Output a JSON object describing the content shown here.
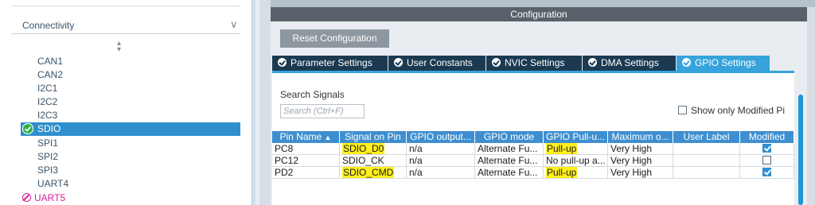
{
  "left_panel": {
    "category": "Connectivity",
    "items": [
      "CAN1",
      "CAN2",
      "I2C1",
      "I2C2",
      "I2C3",
      "SDIO",
      "SPI1",
      "SPI2",
      "SPI3",
      "UART4",
      "UART5"
    ],
    "selected_item": "SDIO"
  },
  "right_panel": {
    "configuration_title": "Configuration",
    "reset_button": "Reset Configuration",
    "tabs": [
      "Parameter Settings",
      "User Constants",
      "NVIC Settings",
      "DMA Settings",
      "GPIO Settings"
    ],
    "active_tab": "GPIO Settings",
    "search": {
      "label": "Search Signals",
      "placeholder": "Search (Ctrl+F)",
      "value": ""
    },
    "show_only_modified": {
      "label": "Show only Modified Pi",
      "checked": false
    },
    "table": {
      "headers": [
        "Pin Name",
        "Signal on Pin",
        "GPIO output...",
        "GPIO mode",
        "GPIO Pull-u...",
        "Maximum o...",
        "User Label",
        "Modified"
      ],
      "rows": [
        {
          "pin": "PC8",
          "signal": "SDIO_D0",
          "output": "n/a",
          "mode": "Alternate Fu...",
          "pull": "Pull-up",
          "max": "Very High",
          "label": "",
          "modified": true,
          "signal_highlight": true,
          "pull_highlight": true
        },
        {
          "pin": "PC12",
          "signal": "SDIO_CK",
          "output": "n/a",
          "mode": "Alternate Fu...",
          "pull": "No pull-up a...",
          "max": "Very High",
          "label": "",
          "modified": false,
          "signal_highlight": false,
          "pull_highlight": false
        },
        {
          "pin": "PD2",
          "signal": "SDIO_CMD",
          "output": "n/a",
          "mode": "Alternate Fu...",
          "pull": "Pull-up",
          "max": "Very High",
          "label": "",
          "modified": true,
          "signal_highlight": true,
          "pull_highlight": true
        }
      ]
    }
  },
  "colors": {
    "selection_blue": "#2f8fcd",
    "tab_dark": "#1b3a52",
    "tab_active": "#36a3dc",
    "header_blue": "#3f8fd0",
    "highlight_yellow": "#ffef1a",
    "disabled_magenta": "#d6209a"
  }
}
